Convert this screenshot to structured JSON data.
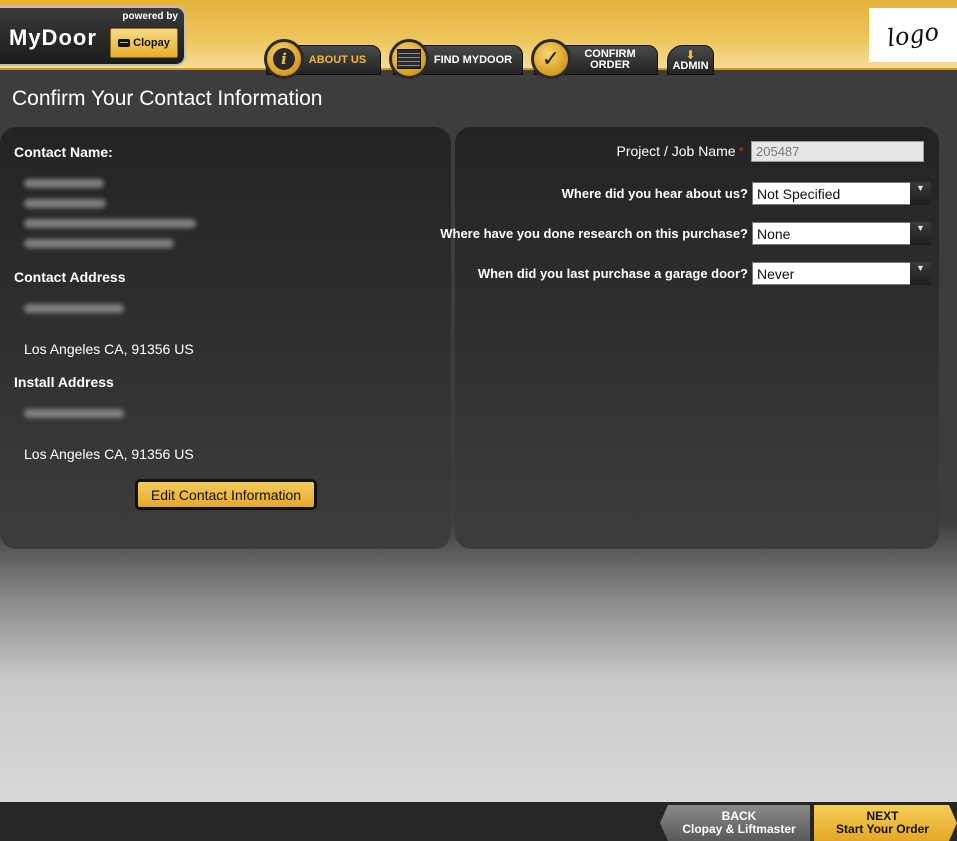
{
  "brand": {
    "name": "MyDoor",
    "powered_by": "powered by",
    "partner": "Clopay"
  },
  "logo": {
    "text": "logo"
  },
  "nav": {
    "tabs": [
      {
        "label": "ABOUT US",
        "icon": "info-icon",
        "active": true
      },
      {
        "label": "FIND MYDOOR",
        "icon": "garage-door-icon"
      },
      {
        "label_line1": "CONFIRM",
        "label_line2": "ORDER",
        "icon": "checkmark-icon"
      },
      {
        "label": "ADMIN",
        "icon": "download-arrow-icon"
      }
    ]
  },
  "page": {
    "title": "Confirm Your Contact Information"
  },
  "contact": {
    "name_heading": "Contact Name:",
    "address_heading": "Contact Address",
    "address_city": "Los Angeles  CA,  91356 US",
    "install_heading": "Install Address",
    "install_city": "Los Angeles  CA,  91356 US",
    "edit_button": "Edit Contact Information"
  },
  "form": {
    "project_label": "Project / Job Name",
    "required_mark": "*",
    "project_value": "205487",
    "hear_label": "Where did you hear about us?",
    "hear_value": "Not Specified",
    "research_label": "Where have you done research on this purchase?",
    "research_value": "None",
    "purchase_label": "When did you last purchase a garage door?",
    "purchase_value": "Never",
    "select_arrow": "▼"
  },
  "footer": {
    "back_line1": "BACK",
    "back_line2": "Clopay & Liftmaster",
    "next_line1": "NEXT",
    "next_line2": "Start Your Order"
  },
  "colors": {
    "accent": "#e6b33a",
    "panel": "#2b2b2b",
    "required": "#e02020"
  }
}
